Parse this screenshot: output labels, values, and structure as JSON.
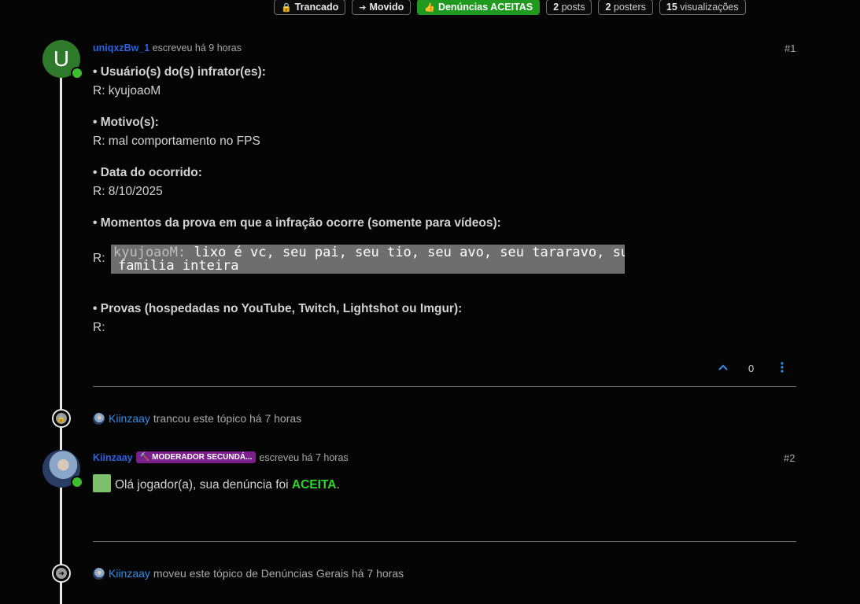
{
  "badges": {
    "locked": "Trancado",
    "moved": "Movido",
    "category": "Denúncias ACEITAS",
    "posts_count": "2",
    "posts_label": "posts",
    "posters_count": "2",
    "posters_label": "posters",
    "views_count": "15",
    "views_label": "visualizações"
  },
  "post1": {
    "avatar_letter": "U",
    "author": "uniqxzBw_1",
    "meta": "escreveu há 9 horas",
    "number": "#1",
    "q1": "• Usuário(s) do(s) infrator(es):",
    "a1": "R: kyujoaoM",
    "q2": "• Motivo(s):",
    "a2": "R: mal comportamento no FPS",
    "q3": "• Data do ocorrido:",
    "a3": "R: 8/10/2025",
    "q4": "• Momentos da prova em que a infração ocorre (somente para vídeos):",
    "a4_prefix": "R:",
    "image_name": "kyujoaoM:",
    "image_line1": " lixo é vc, seu pai, seu tio, seu avo, seu tararavo, sua",
    "image_line2": "familia inteira",
    "q5": "• Provas (hospedadas no YouTube, Twitch, Lightshot ou Imgur):",
    "a5": "R:",
    "votes": "0"
  },
  "event1": {
    "user": "Kiinzaay",
    "text": "trancou este tópico há 7 horas"
  },
  "post2": {
    "author": "Kiinzaay",
    "role": "MODERADOR SECUNDÁ...",
    "meta": "escreveu há 7 horas",
    "number": "#2",
    "text_prefix": "Olá jogador(a), sua denúncia foi",
    "accepted": "ACEITA",
    "text_suffix": "."
  },
  "event2": {
    "user": "Kiinzaay",
    "text": "moveu este tópico de Denúncias Gerais há 7 horas"
  },
  "colors": {
    "accent_green": "#1f9a1f",
    "username_blue": "#2b63e0",
    "accepted_green": "#2dd52d",
    "moderator_purple": "#7a1f8c"
  }
}
